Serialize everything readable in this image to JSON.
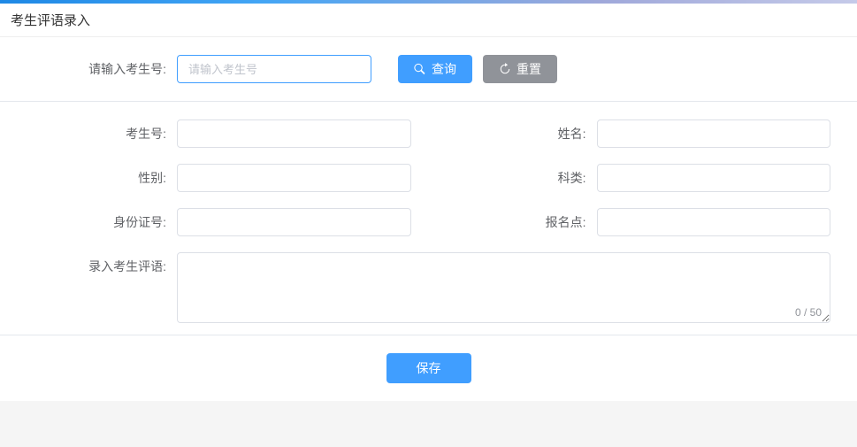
{
  "page_title": "考生评语录入",
  "search": {
    "label": "请输入考生号:",
    "placeholder": "请输入考生号",
    "query_label": "查询",
    "reset_label": "重置"
  },
  "form": {
    "candidate_no": {
      "label": "考生号:",
      "value": ""
    },
    "name": {
      "label": "姓名:",
      "value": ""
    },
    "gender": {
      "label": "性别:",
      "value": ""
    },
    "subject": {
      "label": "科类:",
      "value": ""
    },
    "id_no": {
      "label": "身份证号:",
      "value": ""
    },
    "reg_point": {
      "label": "报名点:",
      "value": ""
    },
    "comment": {
      "label": "录入考生评语:",
      "value": "",
      "count": "0 / 50"
    }
  },
  "footer": {
    "save_label": "保存"
  }
}
